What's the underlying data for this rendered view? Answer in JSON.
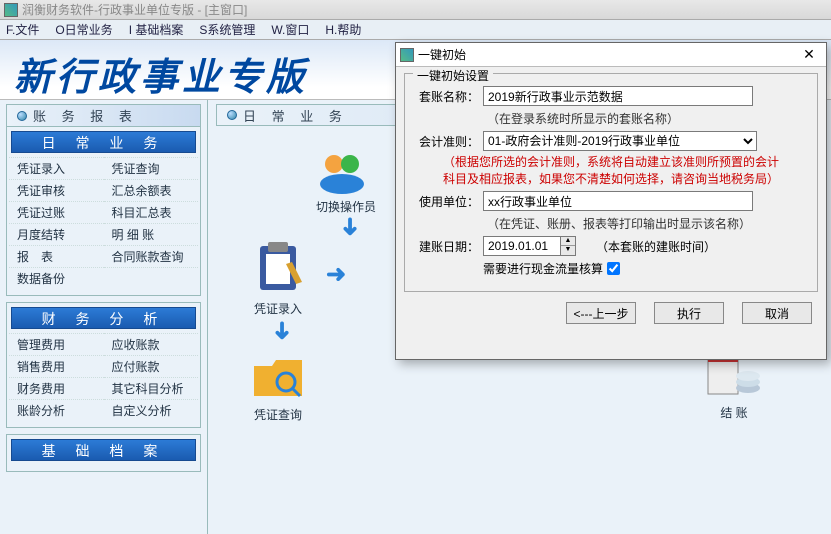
{
  "window_title": "润衡财务软件-行政事业单位专版 - [主窗口]",
  "menu": [
    "F.文件",
    "O日常业务",
    "I 基础档案",
    "S系统管理",
    "W.窗口",
    "H.帮助"
  ],
  "banner_title": "新行政事业专版",
  "sidebar": {
    "panel1_tab": "账 务 报 表",
    "group1_title": "日 常 业 务",
    "group1_items": [
      "凭证录入",
      "凭证查询",
      "凭证审核",
      "汇总余额表",
      "凭证过账",
      "科目汇总表",
      "月度结转",
      "明 细 账",
      "报 表",
      "合同账款查询",
      "数据备份",
      ""
    ],
    "group2_title": "财 务 分 析",
    "group2_items": [
      "管理费用",
      "应收账款",
      "销售费用",
      "应付账款",
      "财务费用",
      "其它科目分析",
      "账龄分析",
      "自定义分析"
    ],
    "group3_title": "基 础 档 案"
  },
  "main": {
    "header": "日 常 业 务",
    "nodes": {
      "switch_user": "切换操作员",
      "voucher_entry": "凭证录入",
      "voucher_query": "凭证查询",
      "closing": "结 账"
    }
  },
  "dialog": {
    "title": "一键初始",
    "legend": "一键初始设置",
    "fields": {
      "book_name_label": "套账名称：",
      "book_name_value": "2019新行政事业示范数据",
      "book_name_hint": "（在登录系统时所显示的套账名称）",
      "rule_label": "会计准则：",
      "rule_value": "01-政府会计准则-2019行政事业单位",
      "rule_warn1": "（根据您所选的会计准则，系统将自动建立该准则所预置的会计",
      "rule_warn2": "科目及相应报表，如果您不清楚如何选择，请咨询当地税务局）",
      "unit_label": "使用单位：",
      "unit_value": "xx行政事业单位",
      "unit_hint": "（在凭证、账册、报表等打印输出时显示该名称）",
      "date_label": "建账日期：",
      "date_value": "2019.01.01",
      "date_hint": "（本套账的建账时间）",
      "cashflow_label": "需要进行现金流量核算"
    },
    "buttons": {
      "prev": "<---上一步",
      "exec": "执行",
      "cancel": "取消"
    }
  }
}
